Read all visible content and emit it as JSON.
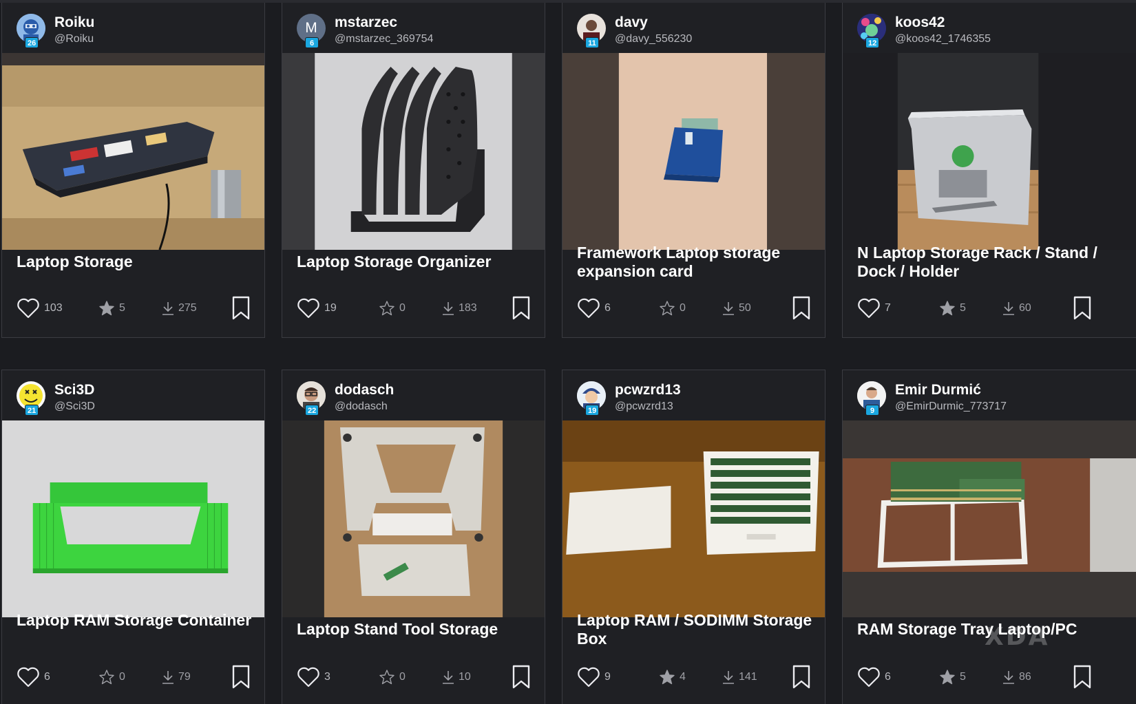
{
  "colors": {
    "background": "#1b1c20",
    "card": "#1f2024",
    "border": "#3b3c42",
    "level_badge": "#1aa7e0"
  },
  "cards": [
    {
      "username": "Roiku",
      "handle": "@Roiku",
      "level": "26",
      "title": "Laptop Storage",
      "likes": "103",
      "stars": "5",
      "downloads": "275",
      "starred": true,
      "avatar_icon": "robot-avatar",
      "image": "laptop-under-desk-photo"
    },
    {
      "username": "mstarzec",
      "handle": "@mstarzec_369754",
      "level": "6",
      "title": "Laptop Storage Organizer",
      "likes": "19",
      "stars": "0",
      "downloads": "183",
      "starred": false,
      "avatar_letter": "M",
      "image": "black-slotted-organizer-render"
    },
    {
      "username": "davy",
      "handle": "@davy_556230",
      "level": "11",
      "title": "Framework Laptop storage expansion card",
      "likes": "6",
      "stars": "0",
      "downloads": "50",
      "starred": false,
      "avatar_icon": "person-avatar",
      "image": "blue-expansion-card-photo"
    },
    {
      "username": "koos42",
      "handle": "@koos42_1746355",
      "level": "12",
      "title": "N Laptop Storage Rack / Stand / Dock / Holder",
      "likes": "7",
      "stars": "5",
      "downloads": "60",
      "starred": true,
      "avatar_icon": "colorful-avatar",
      "image": "laptop-stand-photo"
    },
    {
      "username": "Sci3D",
      "handle": "@Sci3D",
      "level": "21",
      "title": "Laptop RAM Storage Container",
      "likes": "6",
      "stars": "0",
      "downloads": "79",
      "starred": false,
      "avatar_icon": "smiley-avatar",
      "image": "green-ram-container-render"
    },
    {
      "username": "dodasch",
      "handle": "@dodasch",
      "level": "22",
      "title": "Laptop Stand Tool Storage",
      "likes": "3",
      "stars": "0",
      "downloads": "10",
      "starred": false,
      "avatar_icon": "person-glasses-avatar",
      "image": "aluminium-stand-photo"
    },
    {
      "username": "pcwzrd13",
      "handle": "@pcwzrd13",
      "level": "19",
      "title": "Laptop RAM / SODIMM Storage Box",
      "likes": "9",
      "stars": "4",
      "downloads": "141",
      "starred": true,
      "avatar_icon": "cartoon-avatar",
      "image": "white-ram-box-photo"
    },
    {
      "username": "Emir Durmić",
      "handle": "@EmirDurmic_773717",
      "level": "9",
      "title": "RAM Storage Tray Laptop/PC",
      "likes": "6",
      "stars": "5",
      "downloads": "86",
      "starred": true,
      "avatar_icon": "person-avatar",
      "image": "white-ram-tray-photo"
    }
  ],
  "watermark": "XDA"
}
